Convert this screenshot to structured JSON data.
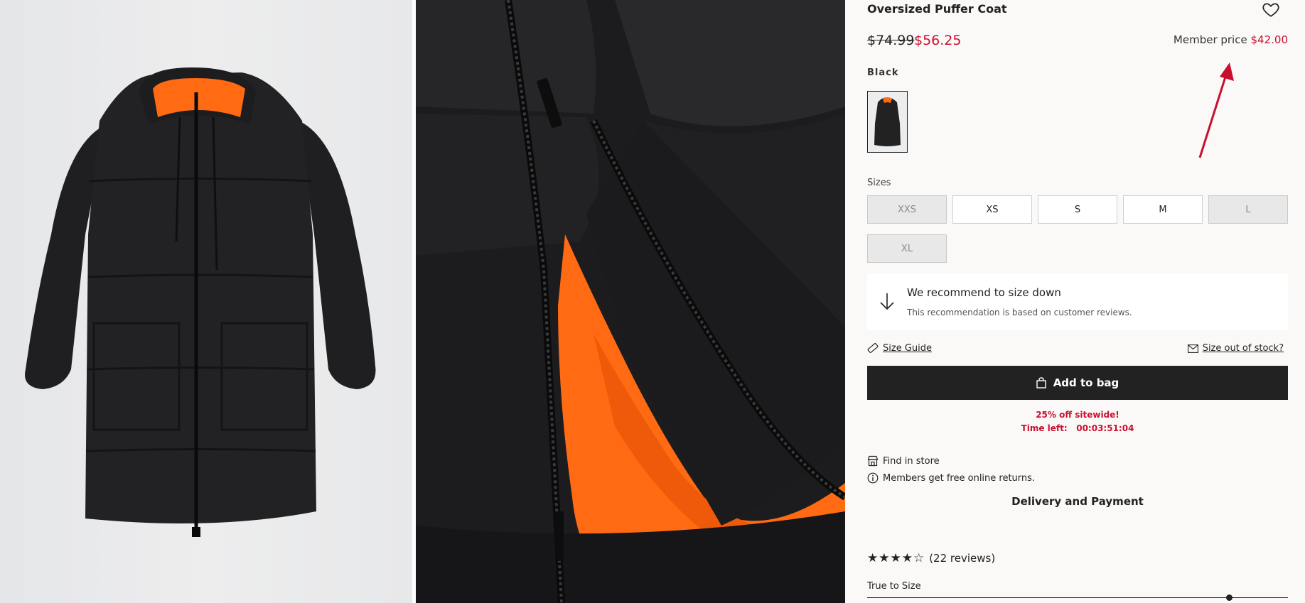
{
  "product": {
    "title": "Oversized Puffer Coat",
    "price_original": "$74.99",
    "price_sale": "$56.25",
    "member_label": "Member price",
    "member_price": "$42.00",
    "color_label": "Black"
  },
  "sizes": {
    "label": "Sizes",
    "options": [
      {
        "label": "XXS",
        "in_stock": false
      },
      {
        "label": "XS",
        "in_stock": true
      },
      {
        "label": "S",
        "in_stock": true
      },
      {
        "label": "M",
        "in_stock": true
      },
      {
        "label": "L",
        "in_stock": false
      },
      {
        "label": "XL",
        "in_stock": false
      }
    ]
  },
  "recommendation": {
    "title": "We recommend to size down",
    "subtitle": "This recommendation is based on customer reviews."
  },
  "links": {
    "size_guide": "Size Guide",
    "size_out_of_stock": "Size out of stock?"
  },
  "add_to_bag": "Add to bag",
  "promo": {
    "line1": "25% off sitewide!",
    "time_label": "Time left:",
    "time_value": "00:03:51:04"
  },
  "store": {
    "find_in_store": "Find in store",
    "returns": "Members get free online returns.",
    "delivery": "Delivery and Payment"
  },
  "reviews": {
    "rating": 4,
    "max": 5,
    "count_text": "(22 reviews)",
    "fit_label": "True to Size",
    "fit_position": 0.86
  },
  "colors": {
    "accent_red": "#c8102e",
    "button_bg": "#222222",
    "lining_orange": "#ff6a13",
    "coat_black": "#1e1e20"
  },
  "icons": {
    "wishlist": "heart-icon",
    "recommend": "arrow-down-icon",
    "size_guide": "ruler-icon",
    "out_of_stock": "envelope-icon",
    "bag": "bag-icon",
    "store": "store-icon",
    "info": "info-icon"
  }
}
